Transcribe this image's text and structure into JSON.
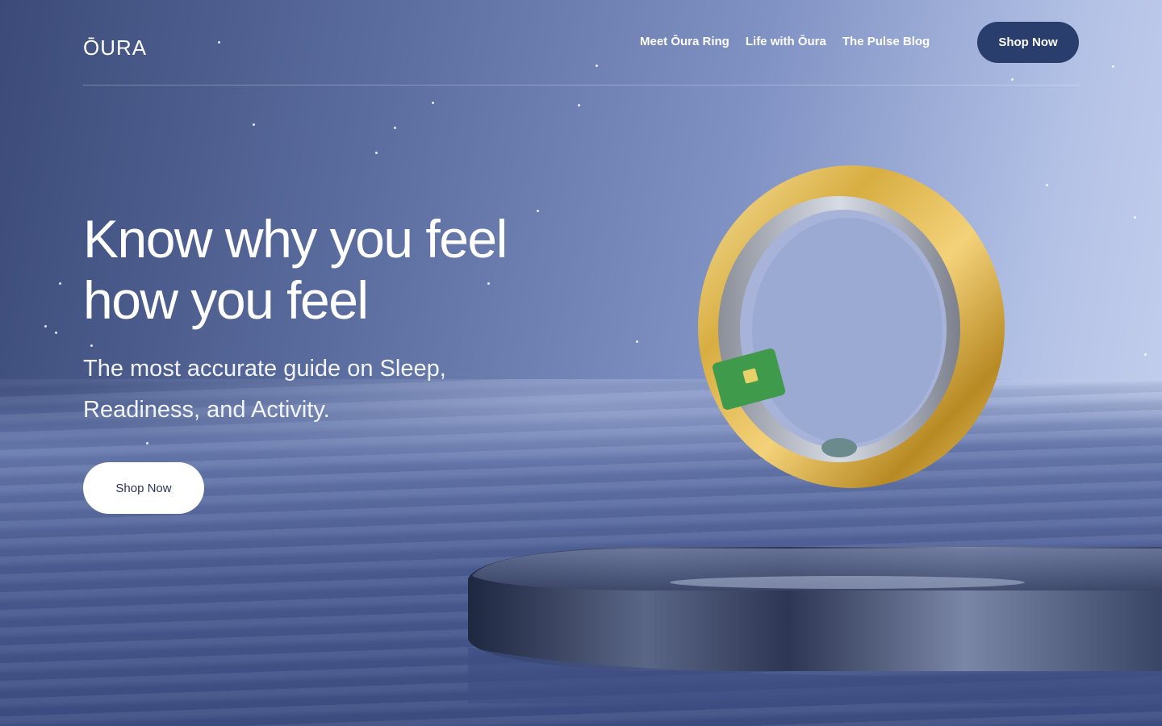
{
  "header": {
    "logo_text": "ŌURA",
    "nav": [
      {
        "label": "Meet Ōura Ring"
      },
      {
        "label": "Life with Ōura"
      },
      {
        "label": "The Pulse Blog"
      }
    ],
    "cta_label": "Shop Now"
  },
  "hero": {
    "title_line1": "Know why you feel",
    "title_line2": "how you feel",
    "subtitle_line1": "The most accurate guide on Sleep,",
    "subtitle_line2": "Readiness, and Activity.",
    "cta_label": "Shop Now"
  },
  "colors": {
    "accent_button": "#2a3e6d",
    "ring_gold": "#d9b24a",
    "background_blue": "#5a6c9e"
  }
}
